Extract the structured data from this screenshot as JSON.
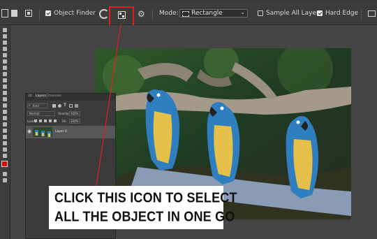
{
  "options_bar": {
    "object_finder_label": "Object Finder",
    "object_finder_checked": true,
    "mode_label": "Mode:",
    "mode_value": "Rectangle",
    "sample_all_layers_label": "Sample All Layers",
    "sample_all_layers_checked": false,
    "hard_edge_label": "Hard Edge",
    "hard_edge_checked": true
  },
  "layers_panel": {
    "tabs": [
      "3D",
      "Layers",
      "Channels"
    ],
    "active_tab": "Layers",
    "kind_label": "Kind",
    "blend_mode": "Normal",
    "opacity_label": "Opacity:",
    "opacity_value": "100%",
    "lock_label": "Lock:",
    "fill_label": "Fill:",
    "fill_value": "100%",
    "layer_name": "Layer 0"
  },
  "callout": {
    "line1": "CLICK THIS ICON TO SELECT",
    "line2": "ALL THE OBJECT IN ONE GO"
  },
  "colors": {
    "highlight": "#e02020",
    "foreground_swatch": "#e00000",
    "background_swatch": "#000000"
  }
}
